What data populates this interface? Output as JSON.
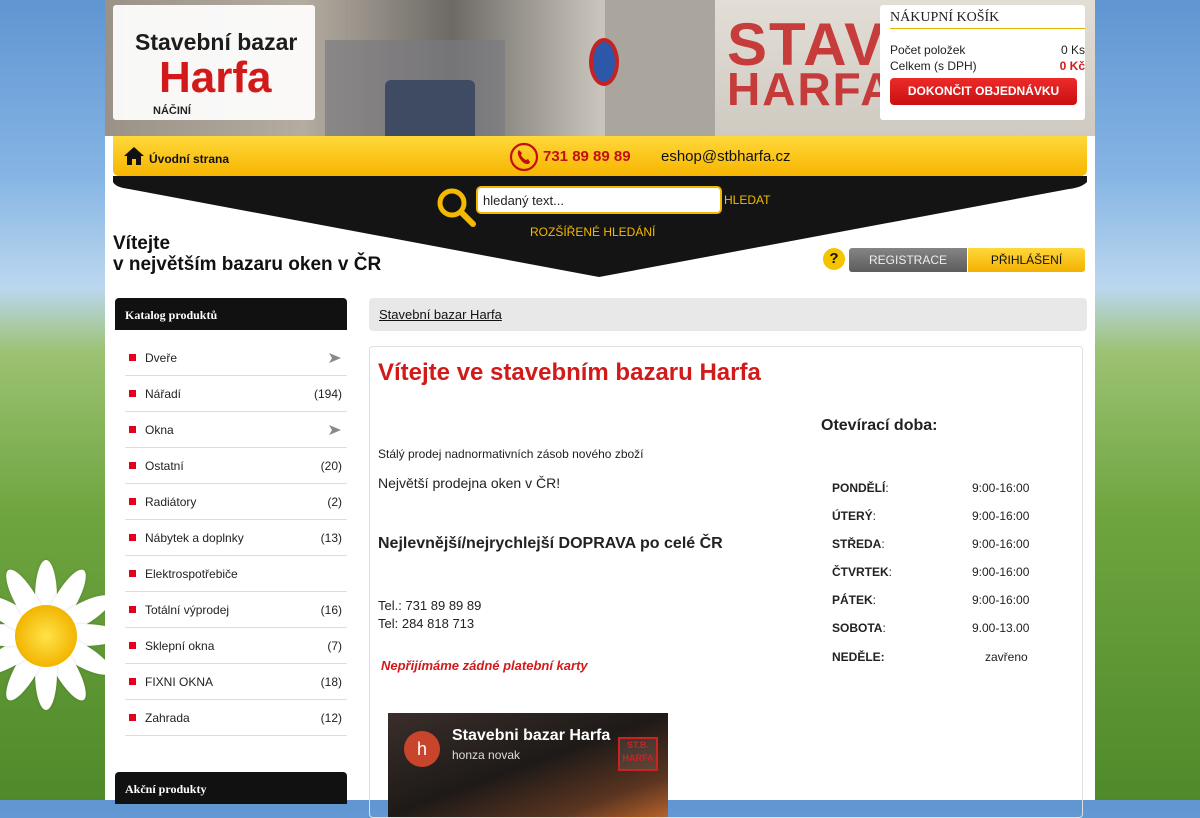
{
  "header": {
    "logo_line1": "Stavební bazar",
    "logo_line2": "Harfa",
    "logo_line3": "NÁČINÍ",
    "banner_text1": "STAVEB",
    "banner_text2": "HARFA"
  },
  "cart": {
    "title": "NÁKUPNÍ KOŠÍK",
    "items_label": "Počet položek",
    "items_value": "0 Ks",
    "total_label": "Celkem (s DPH)",
    "total_value": "0 Kč",
    "checkout_label": "DOKONČIT OBJEDNÁVKU"
  },
  "nav": {
    "home_label": "Úvodní strana",
    "phone": "731 89 89 89",
    "email": "eshop@stbharfa.cz"
  },
  "search": {
    "placeholder": "hledaný text...",
    "button_label": "HLEDAT",
    "advanced_label": "ROZŠÍŘENÉ HLEDÁNÍ"
  },
  "welcome": {
    "line1": "Vítejte",
    "line2": "v největším bazaru oken v ČR"
  },
  "account": {
    "help_symbol": "?",
    "register_label": "REGISTRACE",
    "login_label": "PŘIHLÁŠENÍ"
  },
  "sidebar": {
    "catalog_title": "Katalog produktů",
    "items": [
      {
        "label": "Dveře",
        "count": ""
      },
      {
        "label": "Nářadí",
        "count": "(194)"
      },
      {
        "label": "Okna",
        "count": ""
      },
      {
        "label": "Ostatní",
        "count": "(20)"
      },
      {
        "label": "Radiátory",
        "count": "(2)"
      },
      {
        "label": "Nábytek a doplnky",
        "count": "(13)"
      },
      {
        "label": "Elektrospotřebiče",
        "count": ""
      },
      {
        "label": "Totální výprodej",
        "count": "(16)"
      },
      {
        "label": "Sklepní okna",
        "count": "(7)"
      },
      {
        "label": "FIXNI OKNA",
        "count": "(18)"
      },
      {
        "label": "Zahrada",
        "count": "(12)"
      }
    ],
    "promo_title": "Akční produkty"
  },
  "breadcrumb": {
    "item": "Stavební bazar Harfa"
  },
  "content": {
    "heading": "Vítejte ve stavebním bazaru Harfa",
    "p1": "Stálý prodej nadnormativních zásob nového zboží",
    "p2": "Největší prodejna oken v ČR!",
    "p3": "Nejlevnější/nejrychlejší DOPRAVA po celé ČR",
    "tel1": "Tel.: 731 89 89 89",
    "tel2": "Tel: 284 818 713",
    "notice": "Nepřijímáme zádné platební karty"
  },
  "hours": {
    "title": "Otevírací doba:",
    "rows": [
      {
        "day": "PONDĚLÍ",
        "sep": ":",
        "time": "9:00-16:00"
      },
      {
        "day": "ÚTERÝ",
        "sep": ":",
        "time": "9:00-16:00"
      },
      {
        "day": "STŘEDA",
        "sep": ":",
        "time": "9:00-16:00"
      },
      {
        "day": "ČTVRTEK",
        "sep": ":",
        "time": "9:00-16:00"
      },
      {
        "day": "PÁTEK",
        "sep": ":",
        "time": "9:00-16:00"
      },
      {
        "day": "SOBOTA",
        "sep": ":",
        "time": "9.00-13.00"
      },
      {
        "day": "NEDĚLE:",
        "sep": "",
        "time": "zavřeno"
      }
    ]
  },
  "video": {
    "avatar_letter": "h",
    "title": "Stavebni bazar Harfa",
    "author": "honza novak",
    "stamp": "ST.B. HARFA"
  },
  "icons": {
    "home": "home-icon",
    "phone": "phone-icon",
    "search": "search-icon",
    "arrow": "arrow-right-icon",
    "bullet": "square-bullet-icon"
  },
  "colors": {
    "brand_red": "#d21a1a",
    "brand_yellow": "#f7b500",
    "dark": "#111111"
  }
}
